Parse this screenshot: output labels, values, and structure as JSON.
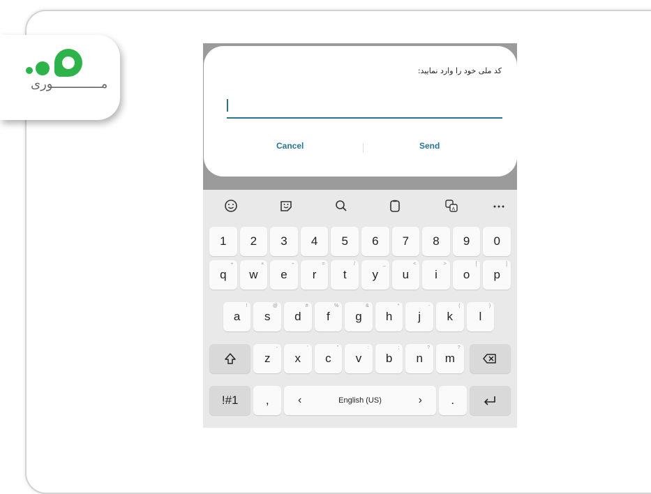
{
  "logo": {
    "wordmark": "مـــــــــــــوری"
  },
  "dialog": {
    "prompt": "کد ملی خود را وارد نمایید:",
    "input_value": "",
    "cancel_label": "Cancel",
    "send_label": "Send"
  },
  "keyboard": {
    "toolbar_icons": [
      "emoji-icon",
      "sticker-icon",
      "search-icon",
      "clipboard-icon",
      "translate-icon",
      "more-icon"
    ],
    "numbers": [
      "1",
      "2",
      "3",
      "4",
      "5",
      "6",
      "7",
      "8",
      "9",
      "0"
    ],
    "row_q": [
      "q",
      "w",
      "e",
      "r",
      "t",
      "y",
      "u",
      "i",
      "o",
      "p"
    ],
    "row_q_hints": [
      "+",
      "×",
      "÷",
      "=",
      "/",
      "_",
      "<",
      ">",
      "[",
      "]"
    ],
    "row_a": [
      "a",
      "s",
      "d",
      "f",
      "g",
      "h",
      "j",
      "k",
      "l"
    ],
    "row_a_hints": [
      "!",
      "@",
      "#",
      "%",
      "&",
      "*",
      "-",
      "(",
      ")"
    ],
    "row_z": [
      "z",
      "x",
      "c",
      "v",
      "b",
      "n",
      "m"
    ],
    "row_z_hints": [
      "-",
      "'",
      "\"",
      ":",
      ";",
      "?",
      "?"
    ],
    "symbols_label": "!#1",
    "comma": ",",
    "space_label": "English (US)",
    "period": "."
  }
}
